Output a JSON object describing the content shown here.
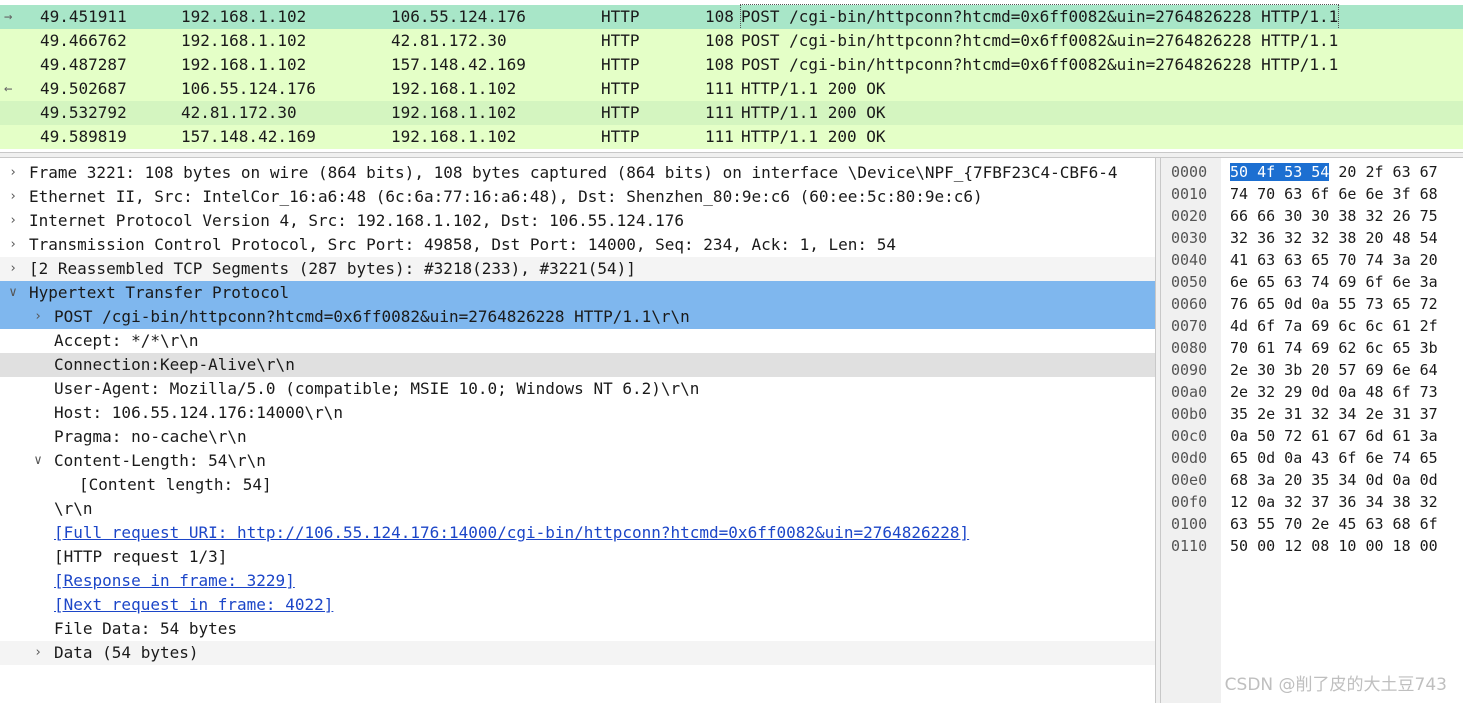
{
  "colors": {
    "packet_selected_bg": "#a8e6c8",
    "packet_http_bg": "#e4ffc7",
    "packet_alt_bg": "#d4f5c0",
    "detail_selected_bg": "#7fb7ee",
    "detail_hover_bg": "#e0e0e0",
    "detail_alt_bg": "#f4f4f4",
    "link": "#1c46c8",
    "hex_selection": "#1c6fd1"
  },
  "packets": [
    {
      "time": "49.451911",
      "src": "192.168.1.102",
      "dst": "106.55.124.176",
      "proto": "HTTP",
      "len": "108",
      "info": "POST /cgi-bin/httpconn?htcmd=0x6ff0082&uin=2764826228 HTTP/1.1",
      "marker": "→",
      "state": "selected"
    },
    {
      "time": "49.466762",
      "src": "192.168.1.102",
      "dst": "42.81.172.30",
      "proto": "HTTP",
      "len": "108",
      "info": "POST /cgi-bin/httpconn?htcmd=0x6ff0082&uin=2764826228 HTTP/1.1",
      "marker": "",
      "state": "normal"
    },
    {
      "time": "49.487287",
      "src": "192.168.1.102",
      "dst": "157.148.42.169",
      "proto": "HTTP",
      "len": "108",
      "info": "POST /cgi-bin/httpconn?htcmd=0x6ff0082&uin=2764826228 HTTP/1.1",
      "marker": "",
      "state": "normal"
    },
    {
      "time": "49.502687",
      "src": "106.55.124.176",
      "dst": "192.168.1.102",
      "proto": "HTTP",
      "len": "111",
      "info": "HTTP/1.1 200 OK",
      "marker": "←",
      "state": "normal"
    },
    {
      "time": "49.532792",
      "src": "42.81.172.30",
      "dst": "192.168.1.102",
      "proto": "HTTP",
      "len": "111",
      "info": "HTTP/1.1 200 OK",
      "marker": "",
      "state": "alt"
    },
    {
      "time": "49.589819",
      "src": "157.148.42.169",
      "dst": "192.168.1.102",
      "proto": "HTTP",
      "len": "111",
      "info": "HTTP/1.1 200 OK",
      "marker": "",
      "state": "normal"
    }
  ],
  "details": [
    {
      "indent": 0,
      "toggle": "collapsed",
      "text": "Frame 3221: 108 bytes on wire (864 bits), 108 bytes captured (864 bits) on interface \\Device\\NPF_{7FBF23C4-CBF6-4",
      "link": false,
      "state": "normal"
    },
    {
      "indent": 0,
      "toggle": "collapsed",
      "text": "Ethernet II, Src: IntelCor_16:a6:48 (6c:6a:77:16:a6:48), Dst: Shenzhen_80:9e:c6 (60:ee:5c:80:9e:c6)",
      "link": false,
      "state": "normal"
    },
    {
      "indent": 0,
      "toggle": "collapsed",
      "text": "Internet Protocol Version 4, Src: 192.168.1.102, Dst: 106.55.124.176",
      "link": false,
      "state": "normal"
    },
    {
      "indent": 0,
      "toggle": "collapsed",
      "text": "Transmission Control Protocol, Src Port: 49858, Dst Port: 14000, Seq: 234, Ack: 1, Len: 54",
      "link": false,
      "state": "normal"
    },
    {
      "indent": 0,
      "toggle": "collapsed",
      "text": "[2 Reassembled TCP Segments (287 bytes): #3218(233), #3221(54)]",
      "link": false,
      "state": "alt"
    },
    {
      "indent": 0,
      "toggle": "expanded",
      "text": "Hypertext Transfer Protocol",
      "link": false,
      "state": "selected"
    },
    {
      "indent": 1,
      "toggle": "collapsed",
      "text": "POST /cgi-bin/httpconn?htcmd=0x6ff0082&uin=2764826228 HTTP/1.1\\r\\n",
      "link": false,
      "state": "selected"
    },
    {
      "indent": 1,
      "toggle": "",
      "text": "Accept: */*\\r\\n",
      "link": false,
      "state": "normal"
    },
    {
      "indent": 1,
      "toggle": "",
      "text": "Connection:Keep-Alive\\r\\n",
      "link": false,
      "state": "hover"
    },
    {
      "indent": 1,
      "toggle": "",
      "text": "User-Agent: Mozilla/5.0 (compatible; MSIE 10.0; Windows NT 6.2)\\r\\n",
      "link": false,
      "state": "normal"
    },
    {
      "indent": 1,
      "toggle": "",
      "text": "Host: 106.55.124.176:14000\\r\\n",
      "link": false,
      "state": "normal"
    },
    {
      "indent": 1,
      "toggle": "",
      "text": "Pragma: no-cache\\r\\n",
      "link": false,
      "state": "normal"
    },
    {
      "indent": 1,
      "toggle": "expanded",
      "text": "Content-Length: 54\\r\\n",
      "link": false,
      "state": "normal"
    },
    {
      "indent": 2,
      "toggle": "",
      "text": "[Content length: 54]",
      "link": false,
      "state": "normal"
    },
    {
      "indent": 1,
      "toggle": "",
      "text": "\\r\\n",
      "link": false,
      "state": "normal"
    },
    {
      "indent": 1,
      "toggle": "",
      "text": "[Full request URI: http://106.55.124.176:14000/cgi-bin/httpconn?htcmd=0x6ff0082&uin=2764826228]",
      "link": true,
      "state": "normal"
    },
    {
      "indent": 1,
      "toggle": "",
      "text": "[HTTP request 1/3]",
      "link": false,
      "state": "normal"
    },
    {
      "indent": 1,
      "toggle": "",
      "text": "[Response in frame: 3229]",
      "link": true,
      "state": "normal"
    },
    {
      "indent": 1,
      "toggle": "",
      "text": "[Next request in frame: 4022]",
      "link": true,
      "state": "normal"
    },
    {
      "indent": 1,
      "toggle": "",
      "text": "File Data: 54 bytes",
      "link": false,
      "state": "normal"
    },
    {
      "indent": 1,
      "toggle": "collapsed",
      "text": "Data (54 bytes)",
      "link": false,
      "state": "alt"
    }
  ],
  "hex": [
    {
      "offset": "0000",
      "sel": "50 4f 53 54",
      "rest": " 20 2f 63 67"
    },
    {
      "offset": "0010",
      "sel": "",
      "rest": "74 70 63 6f 6e 6e 3f 68"
    },
    {
      "offset": "0020",
      "sel": "",
      "rest": "66 66 30 30 38 32 26 75"
    },
    {
      "offset": "0030",
      "sel": "",
      "rest": "32 36 32 32 38 20 48 54"
    },
    {
      "offset": "0040",
      "sel": "",
      "rest": "41 63 63 65 70 74 3a 20"
    },
    {
      "offset": "0050",
      "sel": "",
      "rest": "6e 65 63 74 69 6f 6e 3a"
    },
    {
      "offset": "0060",
      "sel": "",
      "rest": "76 65 0d 0a 55 73 65 72"
    },
    {
      "offset": "0070",
      "sel": "",
      "rest": "4d 6f 7a 69 6c 6c 61 2f"
    },
    {
      "offset": "0080",
      "sel": "",
      "rest": "70 61 74 69 62 6c 65 3b"
    },
    {
      "offset": "0090",
      "sel": "",
      "rest": "2e 30 3b 20 57 69 6e 64"
    },
    {
      "offset": "00a0",
      "sel": "",
      "rest": "2e 32 29 0d 0a 48 6f 73"
    },
    {
      "offset": "00b0",
      "sel": "",
      "rest": "35 2e 31 32 34 2e 31 37"
    },
    {
      "offset": "00c0",
      "sel": "",
      "rest": "0a 50 72 61 67 6d 61 3a"
    },
    {
      "offset": "00d0",
      "sel": "",
      "rest": "65 0d 0a 43 6f 6e 74 65"
    },
    {
      "offset": "00e0",
      "sel": "",
      "rest": "68 3a 20 35 34 0d 0a 0d"
    },
    {
      "offset": "00f0",
      "sel": "",
      "rest": "12 0a 32 37 36 34 38 32"
    },
    {
      "offset": "0100",
      "sel": "",
      "rest": "63 55 70 2e 45 63 68 6f"
    },
    {
      "offset": "0110",
      "sel": "",
      "rest": "50 00 12 08 10 00 18 00"
    }
  ],
  "watermark": "CSDN @削了皮的大土豆743"
}
